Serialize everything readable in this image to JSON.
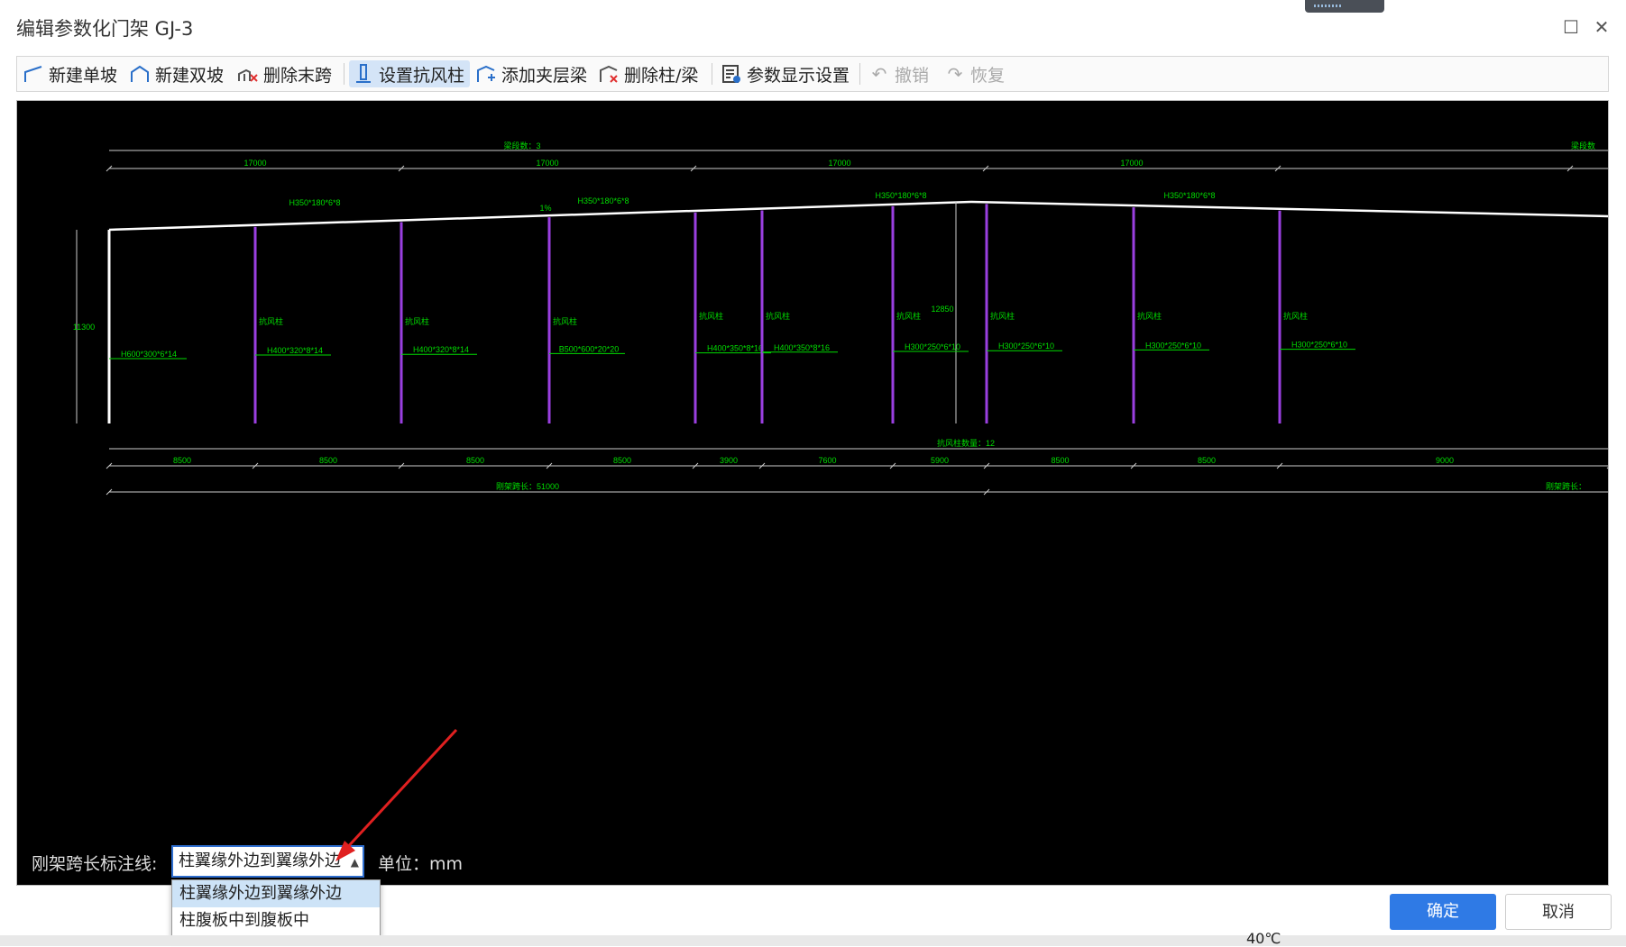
{
  "window": {
    "title": "编辑参数化门架 GJ-3"
  },
  "toolbar": {
    "new_single_slope": "新建单坡",
    "new_double_slope": "新建双坡",
    "delete_last_span": "删除末跨",
    "set_wind_column": "设置抗风柱",
    "add_mezzanine_beam": "添加夹层梁",
    "delete_column_beam": "删除柱/梁",
    "param_display_settings": "参数显示设置",
    "undo": "撤销",
    "redo": "恢复"
  },
  "drawing": {
    "top_dim_label": "梁段数：3",
    "top_dim_label_right": "梁段数",
    "top_spans": [
      "17000",
      "17000",
      "17000",
      "17000"
    ],
    "beam_sections": [
      "H350*180*6*8",
      "H350*180*6*8",
      "H350*180*6*8",
      "H350*180*6*8"
    ],
    "slope_label": "1%",
    "left_height": "11300",
    "ridge_height": "12850",
    "left_column_section": "H600*300*6*14",
    "wind_column_label": "抗风柱",
    "wind_column_sections": [
      "H400*320*8*14",
      "H400*320*8*14",
      "B500*600*20*20",
      "H400*350*8*16",
      "H400*350*8*16",
      "H300*250*6*10",
      "H300*250*6*10",
      "H300*250*6*10",
      "H300*250*6*10"
    ],
    "wind_column_count": "抗风柱数量：12",
    "bottom_spans": [
      "8500",
      "8500",
      "8500",
      "8500",
      "3900",
      "7600",
      "5900",
      "8500",
      "8500",
      "9000"
    ],
    "frame_span_length": "刚架跨长：51000",
    "frame_span_length_right": "刚架跨长："
  },
  "footer": {
    "span_annotation_label": "刚架跨长标注线:",
    "span_annotation_value": "柱翼缘外边到翼缘外边",
    "unit_label": "单位：mm",
    "options": [
      "柱翼缘外边到翼缘外边",
      "柱腹板中到腹板中"
    ],
    "ok": "确定",
    "cancel": "取消"
  },
  "taskbar": {
    "temperature": "40℃"
  },
  "colors": {
    "accent": "#2f7ae5",
    "dim_green": "#00dd00",
    "wind_column": "#9a3fe0",
    "arrow": "#e02020"
  }
}
